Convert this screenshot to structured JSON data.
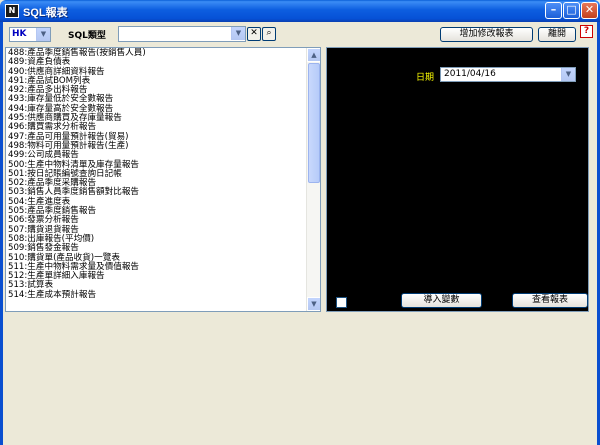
{
  "window": {
    "title": "SQL報表",
    "app_icon": "N"
  },
  "toolbar": {
    "company_value": "HK",
    "sql_type_label": "SQL類型",
    "sql_type_value": "",
    "clear_symbol": "✕",
    "search_symbol": "⌕",
    "add_edit_report_label": "增加修改報表",
    "leave_label": "離開",
    "help_symbol": "?"
  },
  "report_list": [
    "488:產品季度銷售報告(按銷售人員)",
    "489:資產負債表",
    "490:供應商詳細資料報告",
    "491:產品試BOM列表",
    "492:產品多出料報告",
    "493:庫存量低於安全數報告",
    "494:庫存量高於安全數報告",
    "495:供應商購買及存庫量報告",
    "496:購買需求分析報告",
    "497:產品可用量預計報告(貿易)",
    "498:物料可用量預計報告(生產)",
    "499:公司成員報告",
    "500:生產中物料清單及庫存量報告",
    "501:按日記賬編號查詢日記帳",
    "502:產品季度采購報告",
    "503:銷售人員季度銷售額對比報告",
    "504:生產進度表",
    "505:產品季度銷售報告",
    "506:發票分析報告",
    "507:購貨退貨報告",
    "508:出庫報告(平均價)",
    "509:銷售發金報告",
    "510:購貨單(產品收貨)一覽表",
    "511:生產中物料需求量及價值報告",
    "512:生產單詳細入庫報告",
    "513:試算表",
    "514:生產成本預計報告"
  ],
  "params": {
    "date_label": "日期",
    "date_value": "2011/04/16",
    "import_params_label": "導入變數",
    "view_report_label": "查看報表"
  },
  "colors": {
    "title_bar": "#0a5fd8",
    "param_panel_bg": "#000000",
    "param_label": "#ffff00",
    "company_text": "#0000c0"
  }
}
